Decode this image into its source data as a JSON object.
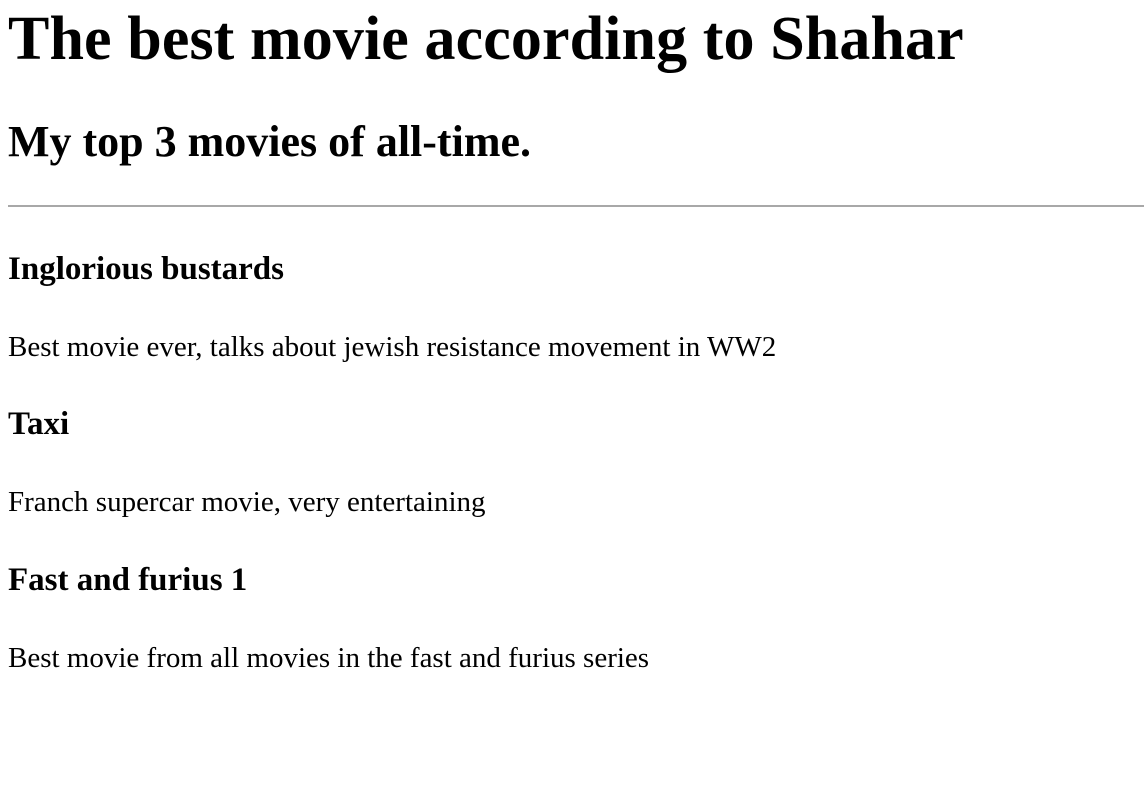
{
  "page": {
    "title": "The best movie according to Shahar",
    "subtitle": "My top 3 movies of all-time."
  },
  "movies": [
    {
      "title": "Inglorious bustards",
      "description": "Best movie ever, talks about jewish resistance movement in WW2"
    },
    {
      "title": "Taxi",
      "description": "Franch supercar movie, very entertaining"
    },
    {
      "title": "Fast and furius 1",
      "description": "Best movie from all movies in the fast and furius series"
    }
  ]
}
